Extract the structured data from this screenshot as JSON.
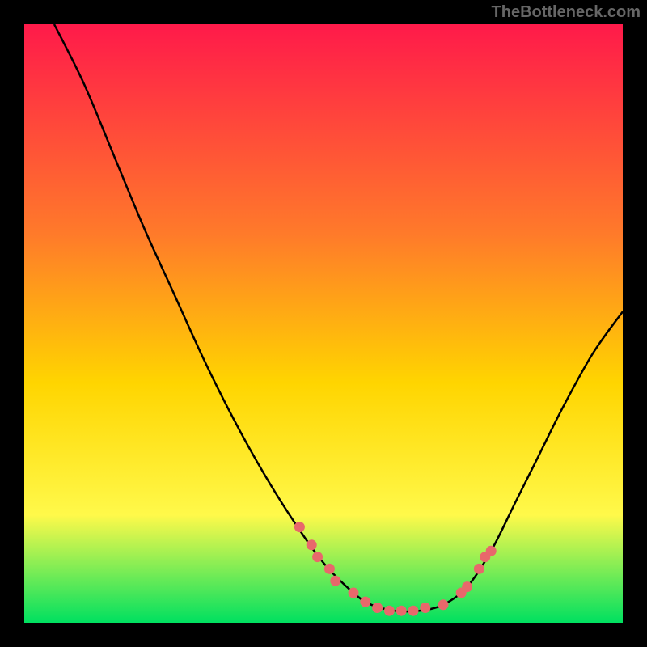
{
  "watermark": "TheBottleneck.com",
  "chart_data": {
    "type": "line",
    "title": "",
    "xlabel": "",
    "ylabel": "",
    "xlim": [
      0,
      100
    ],
    "ylim": [
      0,
      100
    ],
    "gradient_colors": {
      "top": "#ff1a4a",
      "mid1": "#ff7a2a",
      "mid2": "#ffd500",
      "mid3": "#fff94a",
      "bottom": "#00e060"
    },
    "curve": [
      {
        "x": 5,
        "y": 100
      },
      {
        "x": 10,
        "y": 90
      },
      {
        "x": 15,
        "y": 78
      },
      {
        "x": 20,
        "y": 66
      },
      {
        "x": 25,
        "y": 55
      },
      {
        "x": 30,
        "y": 44
      },
      {
        "x": 35,
        "y": 34
      },
      {
        "x": 40,
        "y": 25
      },
      {
        "x": 45,
        "y": 17
      },
      {
        "x": 50,
        "y": 10
      },
      {
        "x": 55,
        "y": 5
      },
      {
        "x": 58,
        "y": 3
      },
      {
        "x": 62,
        "y": 2
      },
      {
        "x": 66,
        "y": 2
      },
      {
        "x": 70,
        "y": 3
      },
      {
        "x": 74,
        "y": 6
      },
      {
        "x": 78,
        "y": 12
      },
      {
        "x": 82,
        "y": 20
      },
      {
        "x": 86,
        "y": 28
      },
      {
        "x": 90,
        "y": 36
      },
      {
        "x": 95,
        "y": 45
      },
      {
        "x": 100,
        "y": 52
      }
    ],
    "marker_points": [
      {
        "x": 46,
        "y": 16
      },
      {
        "x": 48,
        "y": 13
      },
      {
        "x": 49,
        "y": 11
      },
      {
        "x": 51,
        "y": 9
      },
      {
        "x": 52,
        "y": 7
      },
      {
        "x": 55,
        "y": 5
      },
      {
        "x": 57,
        "y": 3.5
      },
      {
        "x": 59,
        "y": 2.5
      },
      {
        "x": 61,
        "y": 2
      },
      {
        "x": 63,
        "y": 2
      },
      {
        "x": 65,
        "y": 2
      },
      {
        "x": 67,
        "y": 2.5
      },
      {
        "x": 70,
        "y": 3
      },
      {
        "x": 73,
        "y": 5
      },
      {
        "x": 74,
        "y": 6
      },
      {
        "x": 76,
        "y": 9
      },
      {
        "x": 77,
        "y": 11
      },
      {
        "x": 78,
        "y": 12
      }
    ],
    "marker_color": "#e8686b",
    "curve_color": "#000000"
  }
}
